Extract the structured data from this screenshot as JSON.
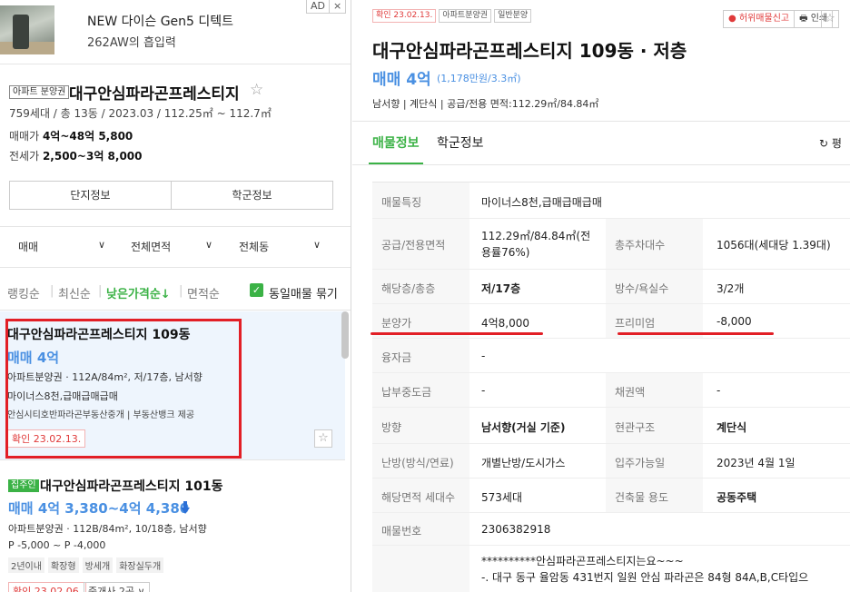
{
  "ad": {
    "title": "NEW 다이슨 Gen5 디텍트",
    "subtitle": "262AW의 흡입력",
    "badge_ad": "AD",
    "badge_close": "×"
  },
  "complex": {
    "badge": "아파트 분양권",
    "name": "대구안심파라곤프레스티지",
    "star": "☆",
    "info": "759세대 / 총 13동 / 2023.03 / 112.25㎡ ~ 112.7㎡",
    "sale_label": "매매가",
    "sale_value": "4억~48억 5,800",
    "jeonse_label": "전세가",
    "jeonse_value": "2,500~3억 8,000",
    "btn_complex": "단지정보",
    "btn_school": "학군정보"
  },
  "filters": {
    "deal": "매매",
    "area": "전체면적",
    "dong": "전체동",
    "chevron": "∨"
  },
  "sort": {
    "ranking": "랭킹순",
    "latest": "최신순",
    "low_price": "낮은가격순↓",
    "area": "면적순",
    "same_toggle": "동일매물 묶기",
    "check": "✓"
  },
  "listings": [
    {
      "title": "대구안심파라곤프레스티지 109동",
      "price": "매매 4억",
      "detail1": "아파트분양권 · 112A/84m², 저/17층, 남서향",
      "detail2": "마이너스8천,급매급매급매",
      "detail3": "안심시티호반파라곤부동산중개 | 부동산뱅크 제공",
      "confirmed": "확인 23.02.13.",
      "star": "☆"
    },
    {
      "badge": "집주인",
      "title": "대구안심파라곤프레스티지 101동",
      "price": "매매 4억 3,380~4억 4,380",
      "detail1": "아파트분양권 · 112B/84m², 10/18층, 남서향",
      "detail2": "P -5,000 ~ P -4,000",
      "tags": [
        "2년이내",
        "확장형",
        "방세개",
        "화장실두개"
      ],
      "confirmed": "확인 23.02.06.",
      "broker": "중개사 2곳 ∨"
    }
  ],
  "detail": {
    "tags": [
      "확인 23.02.13.",
      "아파트분양권",
      "일반분양"
    ],
    "report": "● 허위매물신고",
    "print": "🖶 인쇄",
    "star": "☆",
    "title": "대구안심파라곤프레스티지 109동 · 저층",
    "price": "매매 4억",
    "unit_price": "(1,178만원/3.3㎡)",
    "meta": "남서향 | 계단식 | 공급/전용 면적:112.29㎡/84.84㎡",
    "tab_listing": "매물정보",
    "tab_school": "학군정보",
    "refresh": "↻ 평",
    "rows": {
      "feature_label": "매물특징",
      "feature_value": "마이너스8천,급매급매급매",
      "area_label": "공급/전용면적",
      "area_value_1": "112.29㎡/84.84㎡(전",
      "area_value_2": "용률76%)",
      "parking_label": "총주차대수",
      "parking_value": "1056대(세대당 1.39대)",
      "floor_label": "해당층/총층",
      "floor_value": "저/17층",
      "rooms_label": "방수/욕실수",
      "rooms_value": "3/2개",
      "presale_label": "분양가",
      "presale_value": "4억8,000",
      "premium_label": "프리미엄",
      "premium_value": "-8,000",
      "loan_label": "융자금",
      "loan_value": "-",
      "installment_label": "납부중도금",
      "installment_value": "-",
      "bond_label": "채권액",
      "bond_value": "-",
      "direction_label": "방향",
      "direction_value": "남서향(거실 기준)",
      "entrance_label": "현관구조",
      "entrance_value": "계단식",
      "heating_label": "난방(방식/연료)",
      "heating_value": "개별난방/도시가스",
      "movein_label": "입주가능일",
      "movein_value": "2023년 4월 1일",
      "households_label": "해당면적 세대수",
      "households_value": "573세대",
      "usage_label": "건축물 용도",
      "usage_value": "공동주택",
      "number_label": "매물번호",
      "number_value": "2306382918",
      "desc_1": "**********안심파라곤프레스티지는요~~~",
      "desc_2": "-. 대구 동구 율암동 431번지 일원 안심 파라곤은 84형 84A,B,C타입으"
    }
  }
}
